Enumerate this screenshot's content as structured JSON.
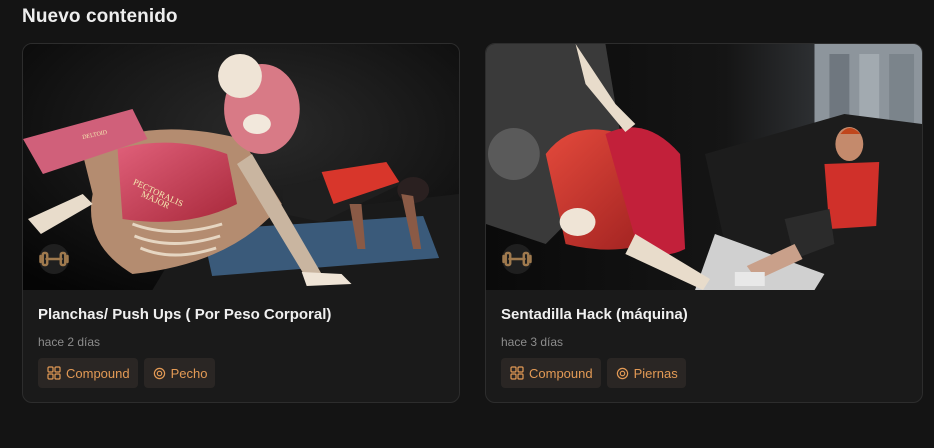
{
  "section": {
    "title": "Nuevo contenido"
  },
  "cards": [
    {
      "title": "Planchas/ Push Ups ( Por Peso Corporal)",
      "time": "hace 2 días",
      "equipment_icon": "dumbbell-icon",
      "image_labels": [
        "PECTORALIS MAJOR",
        "DELTOID"
      ],
      "tags": [
        {
          "label": "Compound",
          "icon": "grid-icon"
        },
        {
          "label": "Pecho",
          "icon": "target-icon"
        }
      ]
    },
    {
      "title": "Sentadilla Hack (máquina)",
      "time": "hace 3 días",
      "equipment_icon": "dumbbell-icon",
      "tags": [
        {
          "label": "Compound",
          "icon": "grid-icon"
        },
        {
          "label": "Piernas",
          "icon": "target-icon"
        }
      ]
    }
  ],
  "colors": {
    "background": "#141414",
    "card": "#1a1a1a",
    "tag_bg": "#2a2624",
    "accent": "#e39a55"
  }
}
